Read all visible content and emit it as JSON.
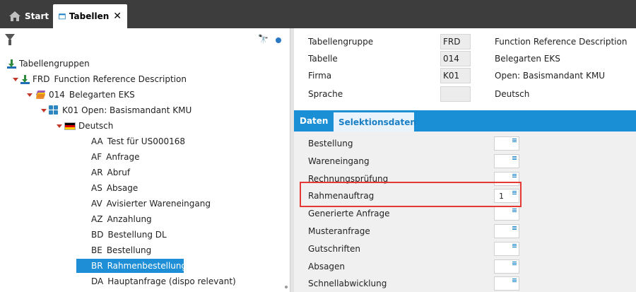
{
  "tabs": {
    "start_label": "Start",
    "active_label": "Tabellen",
    "close_glyph": "✕"
  },
  "tree": {
    "root_label": "Tabellengruppen",
    "group": {
      "code": "FRD",
      "label": "Function Reference Description"
    },
    "table": {
      "code": "014",
      "label": "Belegarten EKS"
    },
    "company": {
      "code": "K01",
      "label": "Open: Basismandant KMU"
    },
    "language": {
      "label": "Deutsch"
    },
    "leaves": [
      {
        "code": "AA",
        "label": "Test für US000168"
      },
      {
        "code": "AF",
        "label": "Anfrage"
      },
      {
        "code": "AR",
        "label": "Abruf"
      },
      {
        "code": "AS",
        "label": "Absage"
      },
      {
        "code": "AV",
        "label": "Avisierter Wareneingang"
      },
      {
        "code": "AZ",
        "label": "Anzahlung"
      },
      {
        "code": "BD",
        "label": "Bestellung DL"
      },
      {
        "code": "BE",
        "label": "Bestellung"
      },
      {
        "code": "BR",
        "label": "Rahmenbestellung"
      },
      {
        "code": "DA",
        "label": "Hauptanfrage (dispo relevant)"
      }
    ],
    "selected_leaf": "BR"
  },
  "header": {
    "rows": [
      {
        "label": "Tabellengruppe",
        "value": "FRD",
        "desc": "Function Reference Description"
      },
      {
        "label": "Tabelle",
        "value": "014",
        "desc": "Belegarten EKS"
      },
      {
        "label": "Firma",
        "value": "K01",
        "desc": "Open: Basismandant KMU"
      },
      {
        "label": "Sprache",
        "value": "",
        "desc": "Deutsch"
      }
    ]
  },
  "detail_tabs": {
    "daten": "Daten",
    "selektionsdaten": "Selektionsdaten"
  },
  "selection": {
    "rows": [
      {
        "label": "Bestellung",
        "value": ""
      },
      {
        "label": "Wareneingang",
        "value": ""
      },
      {
        "label": "Rechnungsprüfung",
        "value": ""
      },
      {
        "label": "Rahmenauftrag",
        "value": "1"
      },
      {
        "label": "Generierte Anfrage",
        "value": ""
      },
      {
        "label": "Musteranfrage",
        "value": ""
      },
      {
        "label": "Gutschriften",
        "value": ""
      },
      {
        "label": "Absagen",
        "value": ""
      },
      {
        "label": "Schnellabwicklung",
        "value": ""
      }
    ]
  },
  "colors": {
    "accent": "#1a8fd5",
    "selected_row": "#1e8fd6",
    "highlight_border": "#e53935",
    "topbar": "#3d3d3d"
  },
  "icons": {
    "start": "home-icon",
    "tabellen": "table-icon",
    "filter": "filter-icon",
    "find": "binoculars-icon"
  }
}
